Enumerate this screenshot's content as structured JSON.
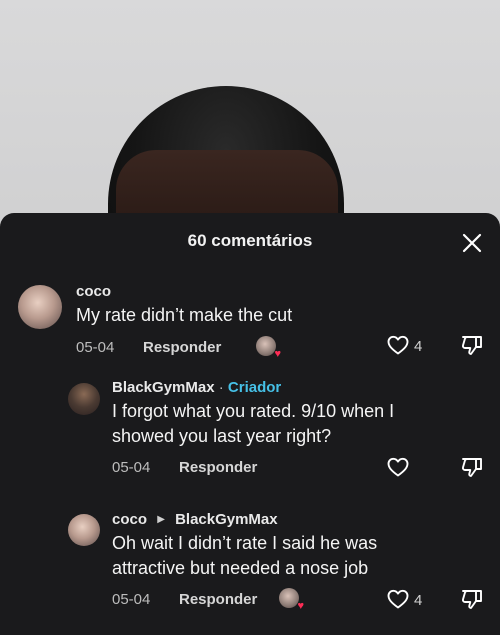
{
  "sheet": {
    "title": "60 comentários"
  },
  "comments": [
    {
      "username": "coco",
      "text": "My rate didn’t make the cut",
      "date": "05-04",
      "reply_label": "Responder",
      "likes": "4"
    },
    {
      "username": "BlackGymMax",
      "separator": "·",
      "badge": "Criador",
      "text": "I forgot what you rated. 9/10 when I showed you last year right?",
      "date": "05-04",
      "reply_label": "Responder"
    },
    {
      "username": "coco",
      "reply_to": "BlackGymMax",
      "text": "Oh wait I didn’t rate I said he was attractive but needed a nose job",
      "date": "05-04",
      "reply_label": "Responder",
      "likes": "4"
    }
  ],
  "colors": {
    "sheet_bg": "#1a1a1c",
    "accent_badge": "#46c0e6",
    "heart": "#fe2c55"
  }
}
